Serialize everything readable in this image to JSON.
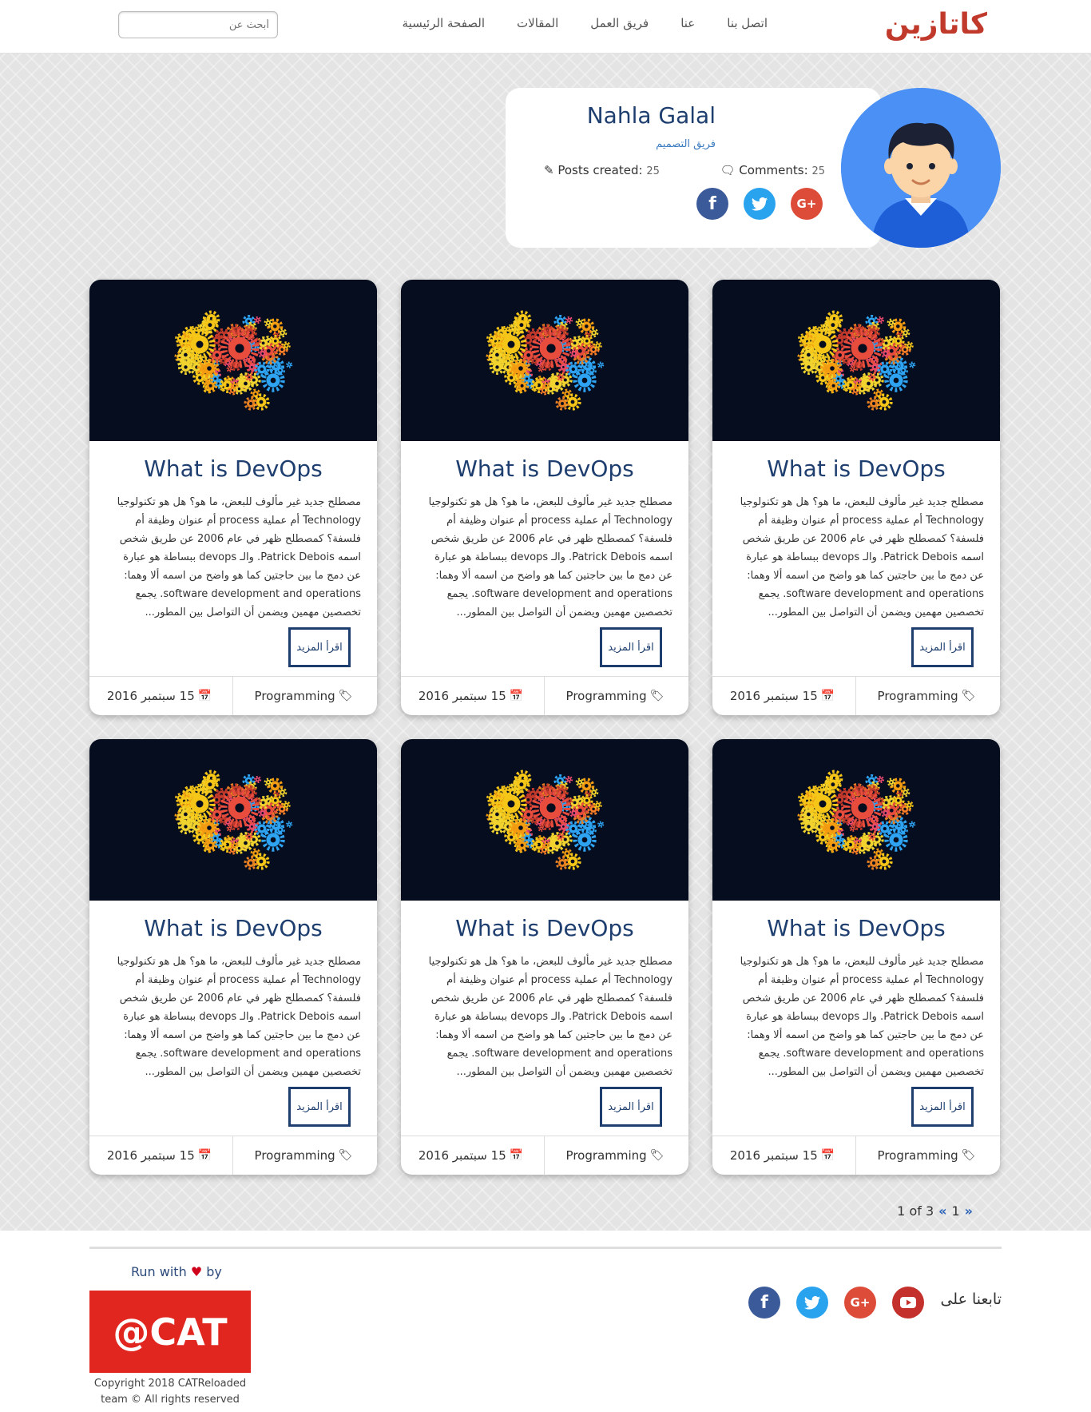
{
  "brand": "كاتازين",
  "nav": {
    "items": [
      {
        "label": "الصفحة الرئيسية"
      },
      {
        "label": "المقالات"
      },
      {
        "label": "فريق العمل"
      },
      {
        "label": "عنا"
      },
      {
        "label": "اتصل بنا"
      }
    ],
    "search_placeholder": "أبحث عن"
  },
  "profile": {
    "name": "Nahla Galal",
    "team": "فريق التصميم",
    "comments_label": "Comments:",
    "comments_count": "25",
    "posts_label": "Posts created:",
    "posts_count": "25",
    "social": [
      "facebook-icon",
      "twitter-icon",
      "google-plus-icon"
    ]
  },
  "cards": [
    {
      "title": "What is DevOps",
      "excerpt": "مصطلح جديد غير مألوف للبعض، ما هو؟ هل هو تكنولوجيا Technology أم عملية process أم عنوان وظيفة أم فلسفة؟ كمصطلح ظهر في عام 2006 عن طريق شخص اسمه Patrick Debois. والـ devops ببساطة هو عبارة عن دمج ما بين حاجتين كما هو واضح من اسمه ألا وهما: software development and operations. يجمع تخصصين مهمين ويضمن أن التواصل بين المطور...",
      "read_more": "اقرأ المزيد",
      "category": "Programming",
      "date": "15 سبتمبر 2016"
    },
    {
      "title": "What is DevOps",
      "excerpt": "مصطلح جديد غير مألوف للبعض، ما هو؟ هل هو تكنولوجيا Technology أم عملية process أم عنوان وظيفة أم فلسفة؟ كمصطلح ظهر في عام 2006 عن طريق شخص اسمه Patrick Debois. والـ devops ببساطة هو عبارة عن دمج ما بين حاجتين كما هو واضح من اسمه ألا وهما: software development and operations. يجمع تخصصين مهمين ويضمن أن التواصل بين المطور...",
      "read_more": "اقرأ المزيد",
      "category": "Programming",
      "date": "15 سبتمبر 2016"
    },
    {
      "title": "What is DevOps",
      "excerpt": "مصطلح جديد غير مألوف للبعض، ما هو؟ هل هو تكنولوجيا Technology أم عملية process أم عنوان وظيفة أم فلسفة؟ كمصطلح ظهر في عام 2006 عن طريق شخص اسمه Patrick Debois. والـ devops ببساطة هو عبارة عن دمج ما بين حاجتين كما هو واضح من اسمه ألا وهما: software development and operations. يجمع تخصصين مهمين ويضمن أن التواصل بين المطور...",
      "read_more": "اقرأ المزيد",
      "category": "Programming",
      "date": "15 سبتمبر 2016"
    },
    {
      "title": "What is DevOps",
      "excerpt": "مصطلح جديد غير مألوف للبعض، ما هو؟ هل هو تكنولوجيا Technology أم عملية process أم عنوان وظيفة أم فلسفة؟ كمصطلح ظهر في عام 2006 عن طريق شخص اسمه Patrick Debois. والـ devops ببساطة هو عبارة عن دمج ما بين حاجتين كما هو واضح من اسمه ألا وهما: software development and operations. يجمع تخصصين مهمين ويضمن أن التواصل بين المطور...",
      "read_more": "اقرأ المزيد",
      "category": "Programming",
      "date": "15 سبتمبر 2016"
    },
    {
      "title": "What is DevOps",
      "excerpt": "مصطلح جديد غير مألوف للبعض، ما هو؟ هل هو تكنولوجيا Technology أم عملية process أم عنوان وظيفة أم فلسفة؟ كمصطلح ظهر في عام 2006 عن طريق شخص اسمه Patrick Debois. والـ devops ببساطة هو عبارة عن دمج ما بين حاجتين كما هو واضح من اسمه ألا وهما: software development and operations. يجمع تخصصين مهمين ويضمن أن التواصل بين المطور...",
      "read_more": "اقرأ المزيد",
      "category": "Programming",
      "date": "15 سبتمبر 2016"
    },
    {
      "title": "What is DevOps",
      "excerpt": "مصطلح جديد غير مألوف للبعض، ما هو؟ هل هو تكنولوجيا Technology أم عملية process أم عنوان وظيفة أم فلسفة؟ كمصطلح ظهر في عام 2006 عن طريق شخص اسمه Patrick Debois. والـ devops ببساطة هو عبارة عن دمج ما بين حاجتين كما هو واضح من اسمه ألا وهما: software development and operations. يجمع تخصصين مهمين ويضمن أن التواصل بين المطور...",
      "read_more": "اقرأ المزيد",
      "category": "Programming",
      "date": "15 سبتمبر 2016"
    }
  ],
  "pagination": {
    "current": "1",
    "text": "1 of 3"
  },
  "footer": {
    "run_with": "Run with",
    "by": "by",
    "logo_text": "@CAT",
    "copyright_line1": "Copyright 2018 CATReloaded",
    "copyright_line2": "team © All rights reserved",
    "follow_us": "تابعنا على",
    "social": [
      "facebook-icon",
      "twitter-icon",
      "google-plus-icon",
      "youtube-icon"
    ]
  },
  "colors": {
    "brand": "#c0392b",
    "title_blue": "#1d3e6e",
    "link_blue": "#3b7bbf",
    "card_image_bg": "#050d1e",
    "facebook": "#3b5a9a",
    "twitter": "#2aa3ef",
    "google_plus": "#dd4b39",
    "youtube": "#c4302b",
    "logo_red": "#e0261f"
  }
}
